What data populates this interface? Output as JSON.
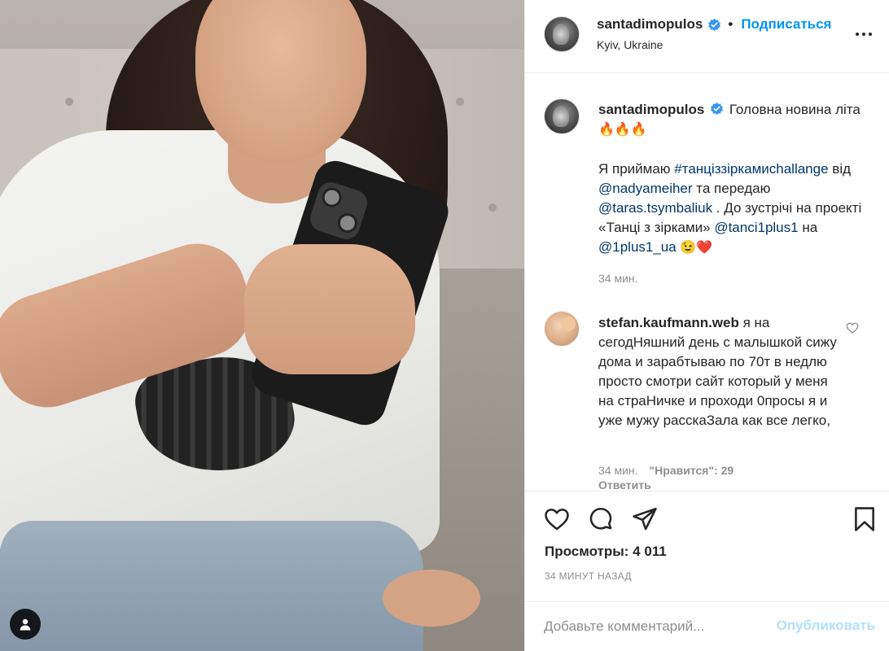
{
  "post": {
    "header": {
      "username": "santadimopulos",
      "separator": "•",
      "follow_label": "Подписаться",
      "location": "Kyiv, Ukraine"
    },
    "caption": {
      "username": "santadimopulos",
      "line1": "Головна новина літа",
      "fire_emoji": "🔥🔥🔥",
      "text_1": "Я приймаю ",
      "hashtag": "#танціззіркамиchallange",
      "text_2": " від ",
      "mention_1": "@nadyameiher",
      "text_3": " та передаю ",
      "mention_2": "@taras.tsymbaliuk",
      "text_4": " . До зустрічі на проекті «Танці з зірками» ",
      "mention_3": "@tanci1plus1",
      "text_5": " на ",
      "mention_4": "@1plus1_ua",
      "end_emoji": " 😉❤️",
      "time": "34 мин."
    },
    "comment": {
      "username": "stefan.kaufmann.web",
      "text": "я на сегодНяшний день с малышкой сижу дома и зарабтываю по 70т в недлю просто смотри сайт который у меня на страНичке и проходи 0просы я и уже мужу расскаЗала как все легко,",
      "time": "34 мин.",
      "likes": "\"Нравится\": 29",
      "reply_label": "Ответить"
    },
    "stats": {
      "views_label": "Просмотры:",
      "views_value": "4 011",
      "posted_ago": "34 МИНУТ НАЗАД"
    },
    "add_comment": {
      "placeholder": "Добавьте комментарий...",
      "publish_label": "Опубликовать"
    },
    "colors": {
      "link": "#00376b",
      "accent": "#0095f6",
      "publish_disabled": "#b2dffc",
      "muted": "#8e8e8e",
      "verified": "#3897f0"
    },
    "icons": [
      "verified-badge-icon",
      "more-options-icon",
      "heart-icon",
      "comment-icon",
      "share-icon",
      "bookmark-icon",
      "user-tag-icon"
    ]
  }
}
